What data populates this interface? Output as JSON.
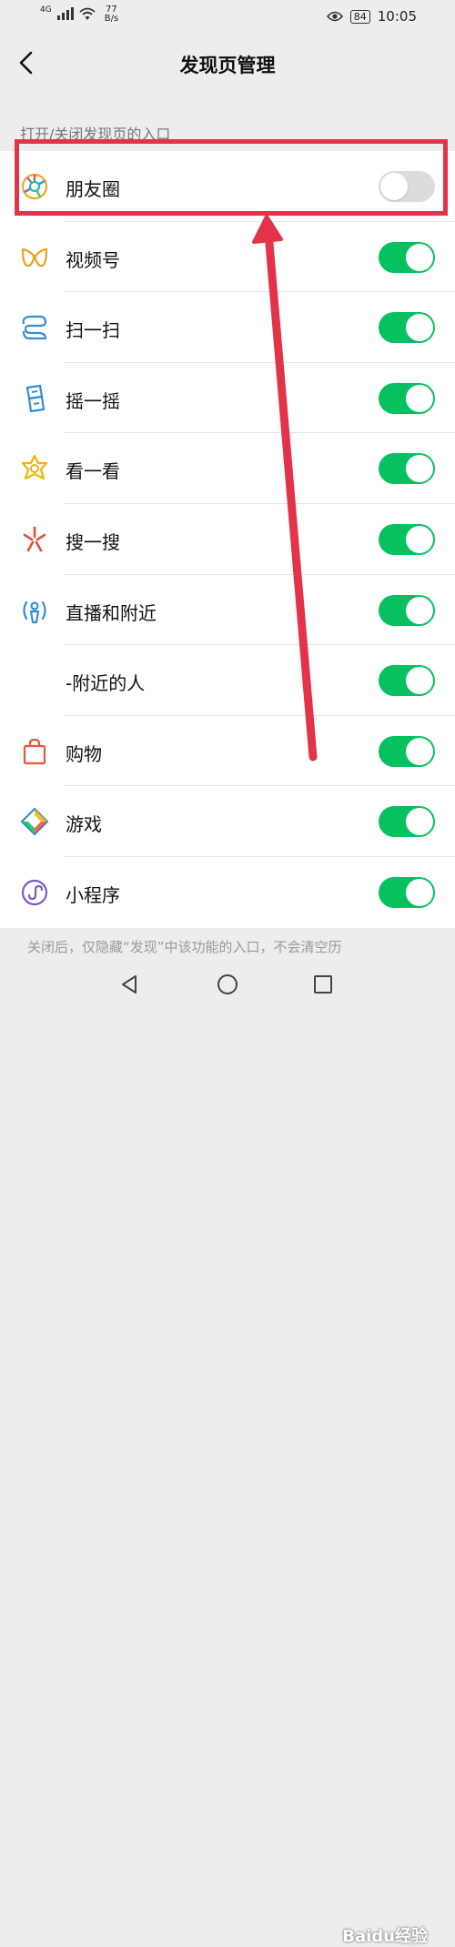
{
  "status_bar": {
    "network": "4G",
    "speed_value": "77",
    "speed_unit": "B/s",
    "battery": "84",
    "time": "10:05"
  },
  "nav": {
    "title": "发现页管理"
  },
  "section_label": "打开/关闭发现页的入口",
  "items": [
    {
      "label": "朋友圈",
      "icon": "moments-icon",
      "enabled": false
    },
    {
      "label": "视频号",
      "icon": "channels-icon",
      "enabled": true
    },
    {
      "label": "扫一扫",
      "icon": "scan-icon",
      "enabled": true
    },
    {
      "label": "摇一摇",
      "icon": "shake-icon",
      "enabled": true
    },
    {
      "label": "看一看",
      "icon": "top-stories-icon",
      "enabled": true
    },
    {
      "label": "搜一搜",
      "icon": "search-icon",
      "enabled": true
    },
    {
      "label": "直播和附近",
      "icon": "live-nearby-icon",
      "enabled": true
    },
    {
      "label": "-附近的人",
      "icon": "",
      "enabled": true
    },
    {
      "label": "购物",
      "icon": "shopping-bag-icon",
      "enabled": true
    },
    {
      "label": "游戏",
      "icon": "games-icon",
      "enabled": true
    },
    {
      "label": "小程序",
      "icon": "mini-programs-icon",
      "enabled": true
    }
  ],
  "footer_note": "关闭后，仅隐藏“发现”中该功能的入口，不会清空历",
  "watermark": "Baidu经验",
  "colors": {
    "toggle_on": "#07c160",
    "toggle_off": "#dcdcdc",
    "annotation": "#e2334a"
  }
}
